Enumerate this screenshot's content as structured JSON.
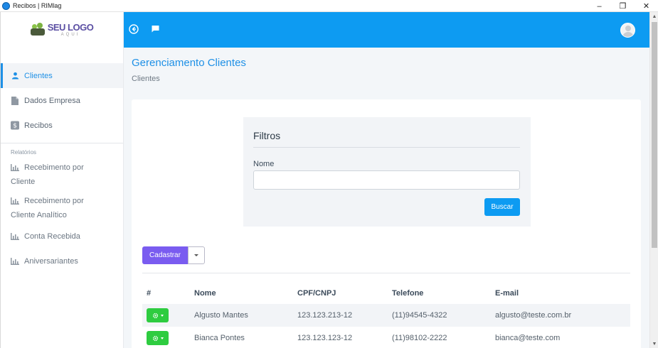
{
  "window": {
    "title": "Recibos | RIMlag",
    "controls": [
      "–",
      "❐",
      "✕"
    ]
  },
  "sidebar": {
    "logo": {
      "main": "SEU LOGO",
      "sub": "AQUI"
    },
    "items": [
      {
        "label": "Clientes",
        "icon": "user-icon",
        "active": true
      },
      {
        "label": "Dados Empresa",
        "icon": "document-icon"
      },
      {
        "label": "Recibos",
        "icon": "dollar-icon"
      }
    ],
    "reports_label": "Relatórios",
    "reports": [
      {
        "line1": "Recebimento por",
        "line2": "Cliente"
      },
      {
        "line1": "Recebimento por",
        "line2": "Cliente Analítico"
      },
      {
        "line1": "Conta Recebida",
        "line2": ""
      },
      {
        "line1": "Aniversariantes",
        "line2": ""
      }
    ]
  },
  "topbar": {
    "accent": "#0d9bf2",
    "icons": [
      "back-circle-icon",
      "chat-icon",
      "avatar"
    ]
  },
  "page": {
    "title": "Gerenciamento Clientes",
    "subtitle": "Clientes"
  },
  "filters": {
    "title": "Filtros",
    "name_label": "Nome",
    "name_value": "",
    "name_placeholder": "",
    "search_button": "Buscar"
  },
  "actions": {
    "create_button": "Cadastrar"
  },
  "table": {
    "headers": [
      "#",
      "Nome",
      "CPF/CNPJ",
      "Telefone",
      "E-mail"
    ],
    "rows": [
      {
        "nome": "Algusto Mantes",
        "cpf": "123.123.213-12",
        "telefone": "(11)94545-4322",
        "email": "algusto@teste.com.br"
      },
      {
        "nome": "Bianca Pontes",
        "cpf": "123.123.123-12",
        "telefone": "(11)98102-2222",
        "email": "bianca@teste.com"
      }
    ]
  },
  "colors": {
    "primary": "#1e90e6",
    "create": "#7a5cf0",
    "action": "#2ecc40"
  }
}
